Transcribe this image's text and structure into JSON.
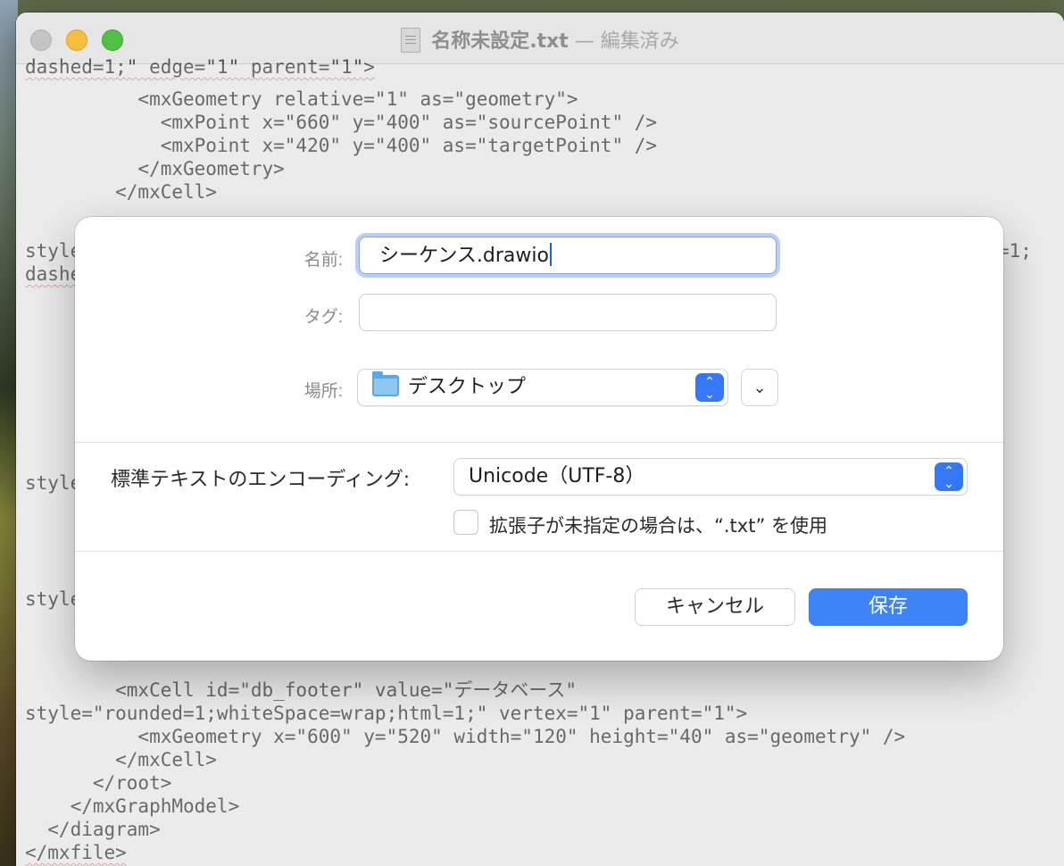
{
  "window": {
    "title": "名称未設定.txt",
    "separator": "—",
    "status": "編集済み"
  },
  "editor": {
    "lines_top": [
      "dashed=1;\" edge=\"1\" parent=\"1\">",
      "          <mxGeometry relative=\"1\" as=\"geometry\">",
      "            <mxPoint x=\"660\" y=\"400\" as=\"sourcePoint\" />",
      "            <mxPoint x=\"420\" y=\"400\" as=\"targetPoint\" />",
      "          </mxGeometry>",
      "        </mxCell>"
    ],
    "side_fragments": {
      "style_1": "style",
      "dashed_1": "dashed",
      "right_1": "=1;",
      "style_2": "style",
      "style_3": "style"
    },
    "lines_bottom": [
      "        <mxCell id=\"db_footer\" value=\"データベース\"",
      "style=\"rounded=1;whiteSpace=wrap;html=1;\" vertex=\"1\" parent=\"1\">",
      "          <mxGeometry x=\"600\" y=\"520\" width=\"120\" height=\"40\" as=\"geometry\" />",
      "        </mxCell>",
      "      </root>",
      "    </mxGraphModel>",
      "  </diagram>",
      "</mxfile>"
    ]
  },
  "dialog": {
    "name_label": "名前:",
    "name_value": "シーケンス.drawio",
    "tag_label": "タグ:",
    "tag_value": "",
    "location_label": "場所:",
    "location_value": "デスクトップ",
    "encoding_label": "標準テキストのエンコーディング:",
    "encoding_value": "Unicode（UTF-8）",
    "extension_checkbox_label": "拡張子が未指定の場合は、“.txt” を使用",
    "extension_checkbox_checked": false,
    "cancel_label": "キャンセル",
    "save_label": "保存"
  },
  "colors": {
    "accent": "#3478f6",
    "save_button": "#3d84f6",
    "focus_ring": "#b9cff5"
  },
  "icons": {
    "location": "folder-icon",
    "stepper": "up-down-chevron-icon",
    "expand": "chevron-down-icon",
    "document": "document-icon"
  }
}
